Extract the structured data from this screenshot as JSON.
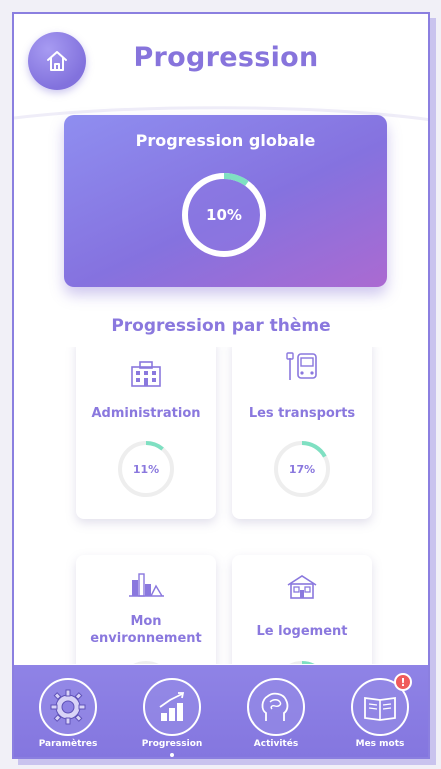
{
  "header": {
    "title": "Progression"
  },
  "global": {
    "title": "Progression globale",
    "percent_label": "10%",
    "percent": 10
  },
  "themes": {
    "section_title": "Progression par thème",
    "items": [
      {
        "label": "Administration",
        "percent_label": "11%",
        "percent": 11,
        "icon": "building-icon"
      },
      {
        "label": "Les transports",
        "percent_label": "17%",
        "percent": 17,
        "icon": "bus-icon"
      },
      {
        "label": "Mon environnement",
        "percent_label": "",
        "icon": "city-icon"
      },
      {
        "label": "Le logement",
        "percent_label": "",
        "icon": "house-icon"
      }
    ]
  },
  "nav": {
    "items": [
      {
        "label": "Paramètres",
        "icon": "gear-icon"
      },
      {
        "label": "Progression",
        "icon": "chart-icon"
      },
      {
        "label": "Activités",
        "icon": "brain-icon"
      },
      {
        "label": "Mes mots",
        "icon": "book-icon"
      }
    ],
    "badge": "!"
  },
  "colors": {
    "accent": "#8774dc",
    "progress": "#7fe0c2",
    "badge": "#ef5b5b"
  }
}
